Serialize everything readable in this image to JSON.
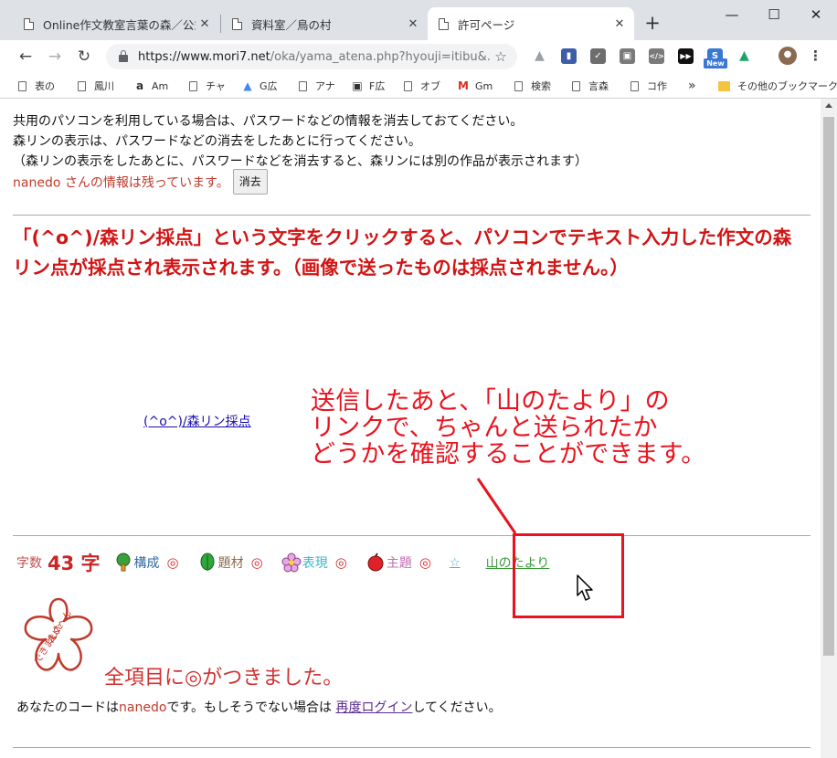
{
  "tabs": [
    {
      "title": "Online作文教室言葉の森／公式",
      "active": false
    },
    {
      "title": "資料室／鳥の村",
      "active": false
    },
    {
      "title": "許可ページ",
      "active": true
    }
  ],
  "window_controls": {
    "minimize": "—",
    "maximize": "☐",
    "close": "✕"
  },
  "toolbar": {
    "back": "←",
    "forward": "→",
    "reload": "↻",
    "url_host": "https://www.mori7.net",
    "url_path": "/oka/yama_atena.php?hyouji=itibu&...",
    "star": "☆",
    "extensions": [
      {
        "name": "drive-dim-icon",
        "color": "#9aa0a6",
        "glyph": "▲"
      },
      {
        "name": "bookmark-blue-icon",
        "color": "#3c5ea8",
        "glyph": "▮"
      },
      {
        "name": "check-icon",
        "color": "#6d6d6d",
        "glyph": "✓"
      },
      {
        "name": "gray-square-icon",
        "color": "#7a7a7a",
        "glyph": "▣"
      },
      {
        "name": "code-icon",
        "color": "#7a7a7a",
        "glyph": "</>"
      },
      {
        "name": "media-next-icon",
        "color": "#111111",
        "glyph": "▶▶"
      },
      {
        "name": "new-extension-icon",
        "color": "#3a78d4",
        "glyph": "S"
      },
      {
        "name": "google-drive-icon",
        "color": "#1fa463",
        "glyph": "▲"
      },
      {
        "name": "avatar-icon",
        "color": "#8a6a50",
        "glyph": "●"
      },
      {
        "name": "menu-icon",
        "color": "#ffffff",
        "glyph": "⋮"
      }
    ],
    "new_badge": "New"
  },
  "bookmarks": [
    {
      "label": "表の",
      "glyph": ""
    },
    {
      "label": "鳳川",
      "glyph": ""
    },
    {
      "label": "Am",
      "glyph": "a"
    },
    {
      "label": "チャ",
      "glyph": ""
    },
    {
      "label": "G広",
      "glyph": "▲"
    },
    {
      "label": "アナ",
      "glyph": ""
    },
    {
      "label": "F広",
      "glyph": "▣"
    },
    {
      "label": "オブ",
      "glyph": ""
    },
    {
      "label": "Gm",
      "glyph": "M"
    },
    {
      "label": "検索",
      "glyph": ""
    },
    {
      "label": "言森",
      "glyph": ""
    },
    {
      "label": "コ作",
      "glyph": ""
    }
  ],
  "bookmarks_more": "»",
  "bookmarks_other": "その他のブックマーク",
  "notice": {
    "line1": "共用のパソコンを利用している場合は、パスワードなどの情報を消去しておてください。",
    "line2": "森リンの表示は、パスワードなどの消去をしたあとに行ってください。",
    "line3": "（森リンの表示をしたあとに、パスワードなどを消去すると、森リンには別の作品が表示されます）",
    "saved": "nanedo さんの情報は残っています。",
    "clear_button": "消去"
  },
  "instruction": "「(^o^)/森リン採点」という文字をクリックすると、パソコンでテキスト入力した作文の森リン点が採点され表示されます。（画像で送ったものは採点されません。）",
  "score_link": "(^o^)/森リン採点",
  "callout": {
    "line1": "送信したあと、「山のたより」の",
    "line2": "リンクで、ちゃんと送られたか",
    "line3": "どうかを確認することができます。"
  },
  "word_count": {
    "label": "字数",
    "value": "43 字"
  },
  "categories": [
    {
      "name": "構成",
      "mark": "◎",
      "color": "#2e6aa3"
    },
    {
      "name": "題材",
      "mark": "◎",
      "color": "#8a6a4a"
    },
    {
      "name": "表現",
      "mark": "◎",
      "color": "#3ab5c8"
    },
    {
      "name": "主題",
      "mark": "◎",
      "color": "#c06fb2"
    }
  ],
  "star_link": "☆",
  "yama_link": "山のたより",
  "stamp_lines": [
    "たいへん",
    "よく",
    "できました"
  ],
  "all_done": "全項目に◎がつきました。",
  "code_line": {
    "prefix": "あなたのコードは",
    "code": "nanedo",
    "middle": "です。もしそうでない場合は ",
    "link": "再度ログイン",
    "suffix": "してください。"
  }
}
